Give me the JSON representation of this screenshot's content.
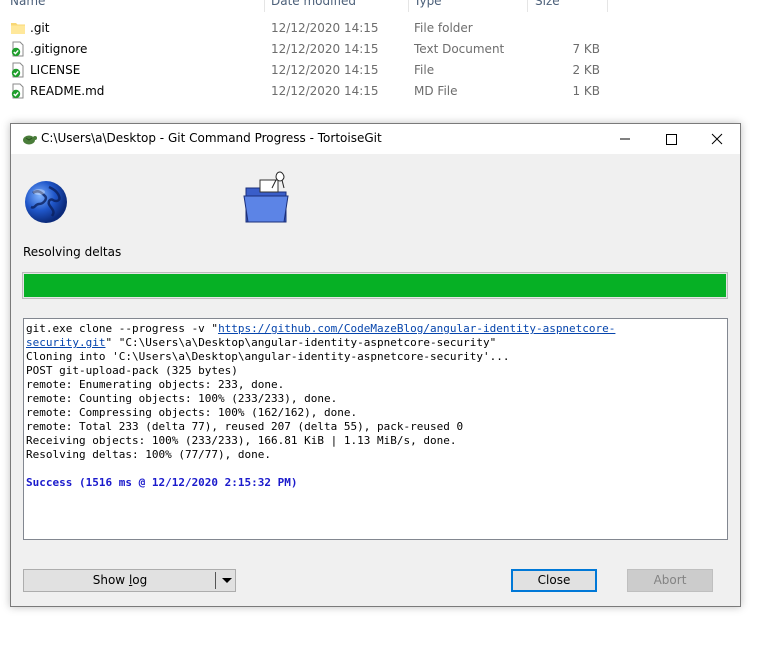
{
  "explorer": {
    "columns": [
      "Name",
      "Date modified",
      "Type",
      "Size"
    ],
    "files": [
      {
        "name": ".git",
        "date": "12/12/2020 14:15",
        "type": "File folder",
        "size": "",
        "icon": "folder-icon"
      },
      {
        "name": ".gitignore",
        "date": "12/12/2020 14:15",
        "type": "Text Document",
        "size": "7 KB",
        "icon": "git-tracked-file-icon"
      },
      {
        "name": "LICENSE",
        "date": "12/12/2020 14:15",
        "type": "File",
        "size": "2 KB",
        "icon": "git-tracked-file-icon"
      },
      {
        "name": "README.md",
        "date": "12/12/2020 14:15",
        "type": "MD File",
        "size": "1 KB",
        "icon": "git-tracked-file-icon"
      }
    ]
  },
  "dialog": {
    "title": "C:\\Users\\a\\Desktop - Git Command Progress - TortoiseGit",
    "status": "Resolving deltas",
    "progress": 1.0,
    "progress_color": "#06b025",
    "log": {
      "cmd_prefix": "git.exe clone --progress -v \"",
      "url_part1": "https://github.com/CodeMazeBlog/angular-identity-aspnetcore-",
      "url_part2": "security.git",
      "cmd_suffix": "\" \"C:\\Users\\a\\Desktop\\angular-identity-aspnetcore-security\"",
      "lines": [
        "Cloning into 'C:\\Users\\a\\Desktop\\angular-identity-aspnetcore-security'...",
        "POST git-upload-pack (325 bytes)",
        "remote: Enumerating objects: 233, done.",
        "remote: Counting objects: 100% (233/233), done.",
        "remote: Compressing objects: 100% (162/162), done.",
        "remote: Total 233 (delta 77), reused 207 (delta 55), pack-reused 0",
        "Receiving objects: 100% (233/233), 166.81 KiB | 1.13 MiB/s, done.",
        "Resolving deltas: 100% (77/77), done."
      ],
      "success": "Success (1516 ms @ 12/12/2020 2:15:32 PM)"
    },
    "buttons": {
      "show_log_pre": "Show ",
      "show_log_accel": "l",
      "show_log_post": "og",
      "close": "Close",
      "abort": "Abort"
    }
  }
}
